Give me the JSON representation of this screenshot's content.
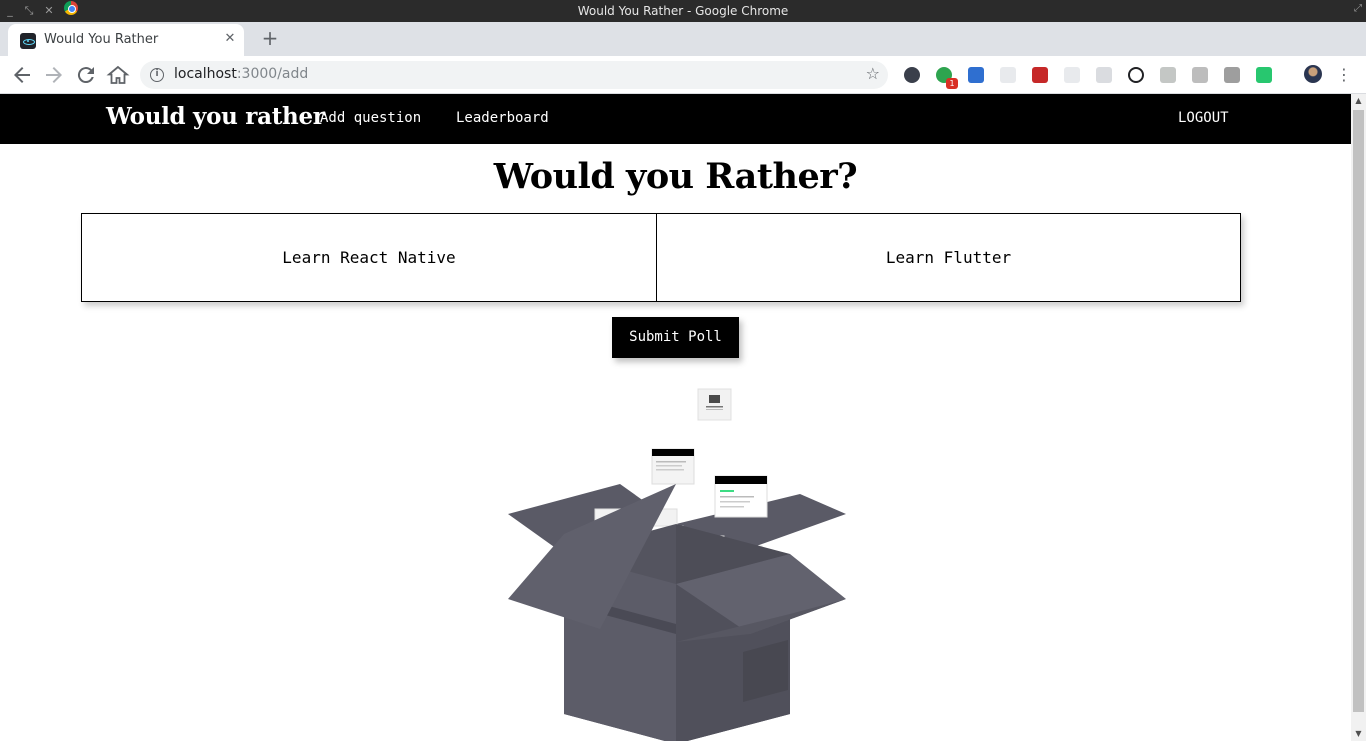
{
  "os": {
    "window_title": "Would You Rather - Google Chrome",
    "controls": [
      "_",
      "⤡",
      "✕"
    ]
  },
  "browser": {
    "tab_title": "Would You Rather",
    "tab_close": "✕",
    "new_tab": "+",
    "url_host": "localhost",
    "url_path": ":3000/add",
    "extension_badge": "1",
    "icons": [
      "back-icon",
      "forward-icon",
      "reload-icon",
      "home-icon",
      "info-icon",
      "star-icon",
      "menu-icon"
    ]
  },
  "nav": {
    "brand": "Would you rather",
    "links": [
      "Add question",
      "Leaderboard"
    ],
    "logout": "LOGOUT"
  },
  "main": {
    "title": "Would you Rather?",
    "option_one": "Learn React Native",
    "option_two": "Learn Flutter",
    "submit": "Submit Poll"
  },
  "colors": {
    "nav_bg": "#000000",
    "box_color": "#53535f"
  }
}
